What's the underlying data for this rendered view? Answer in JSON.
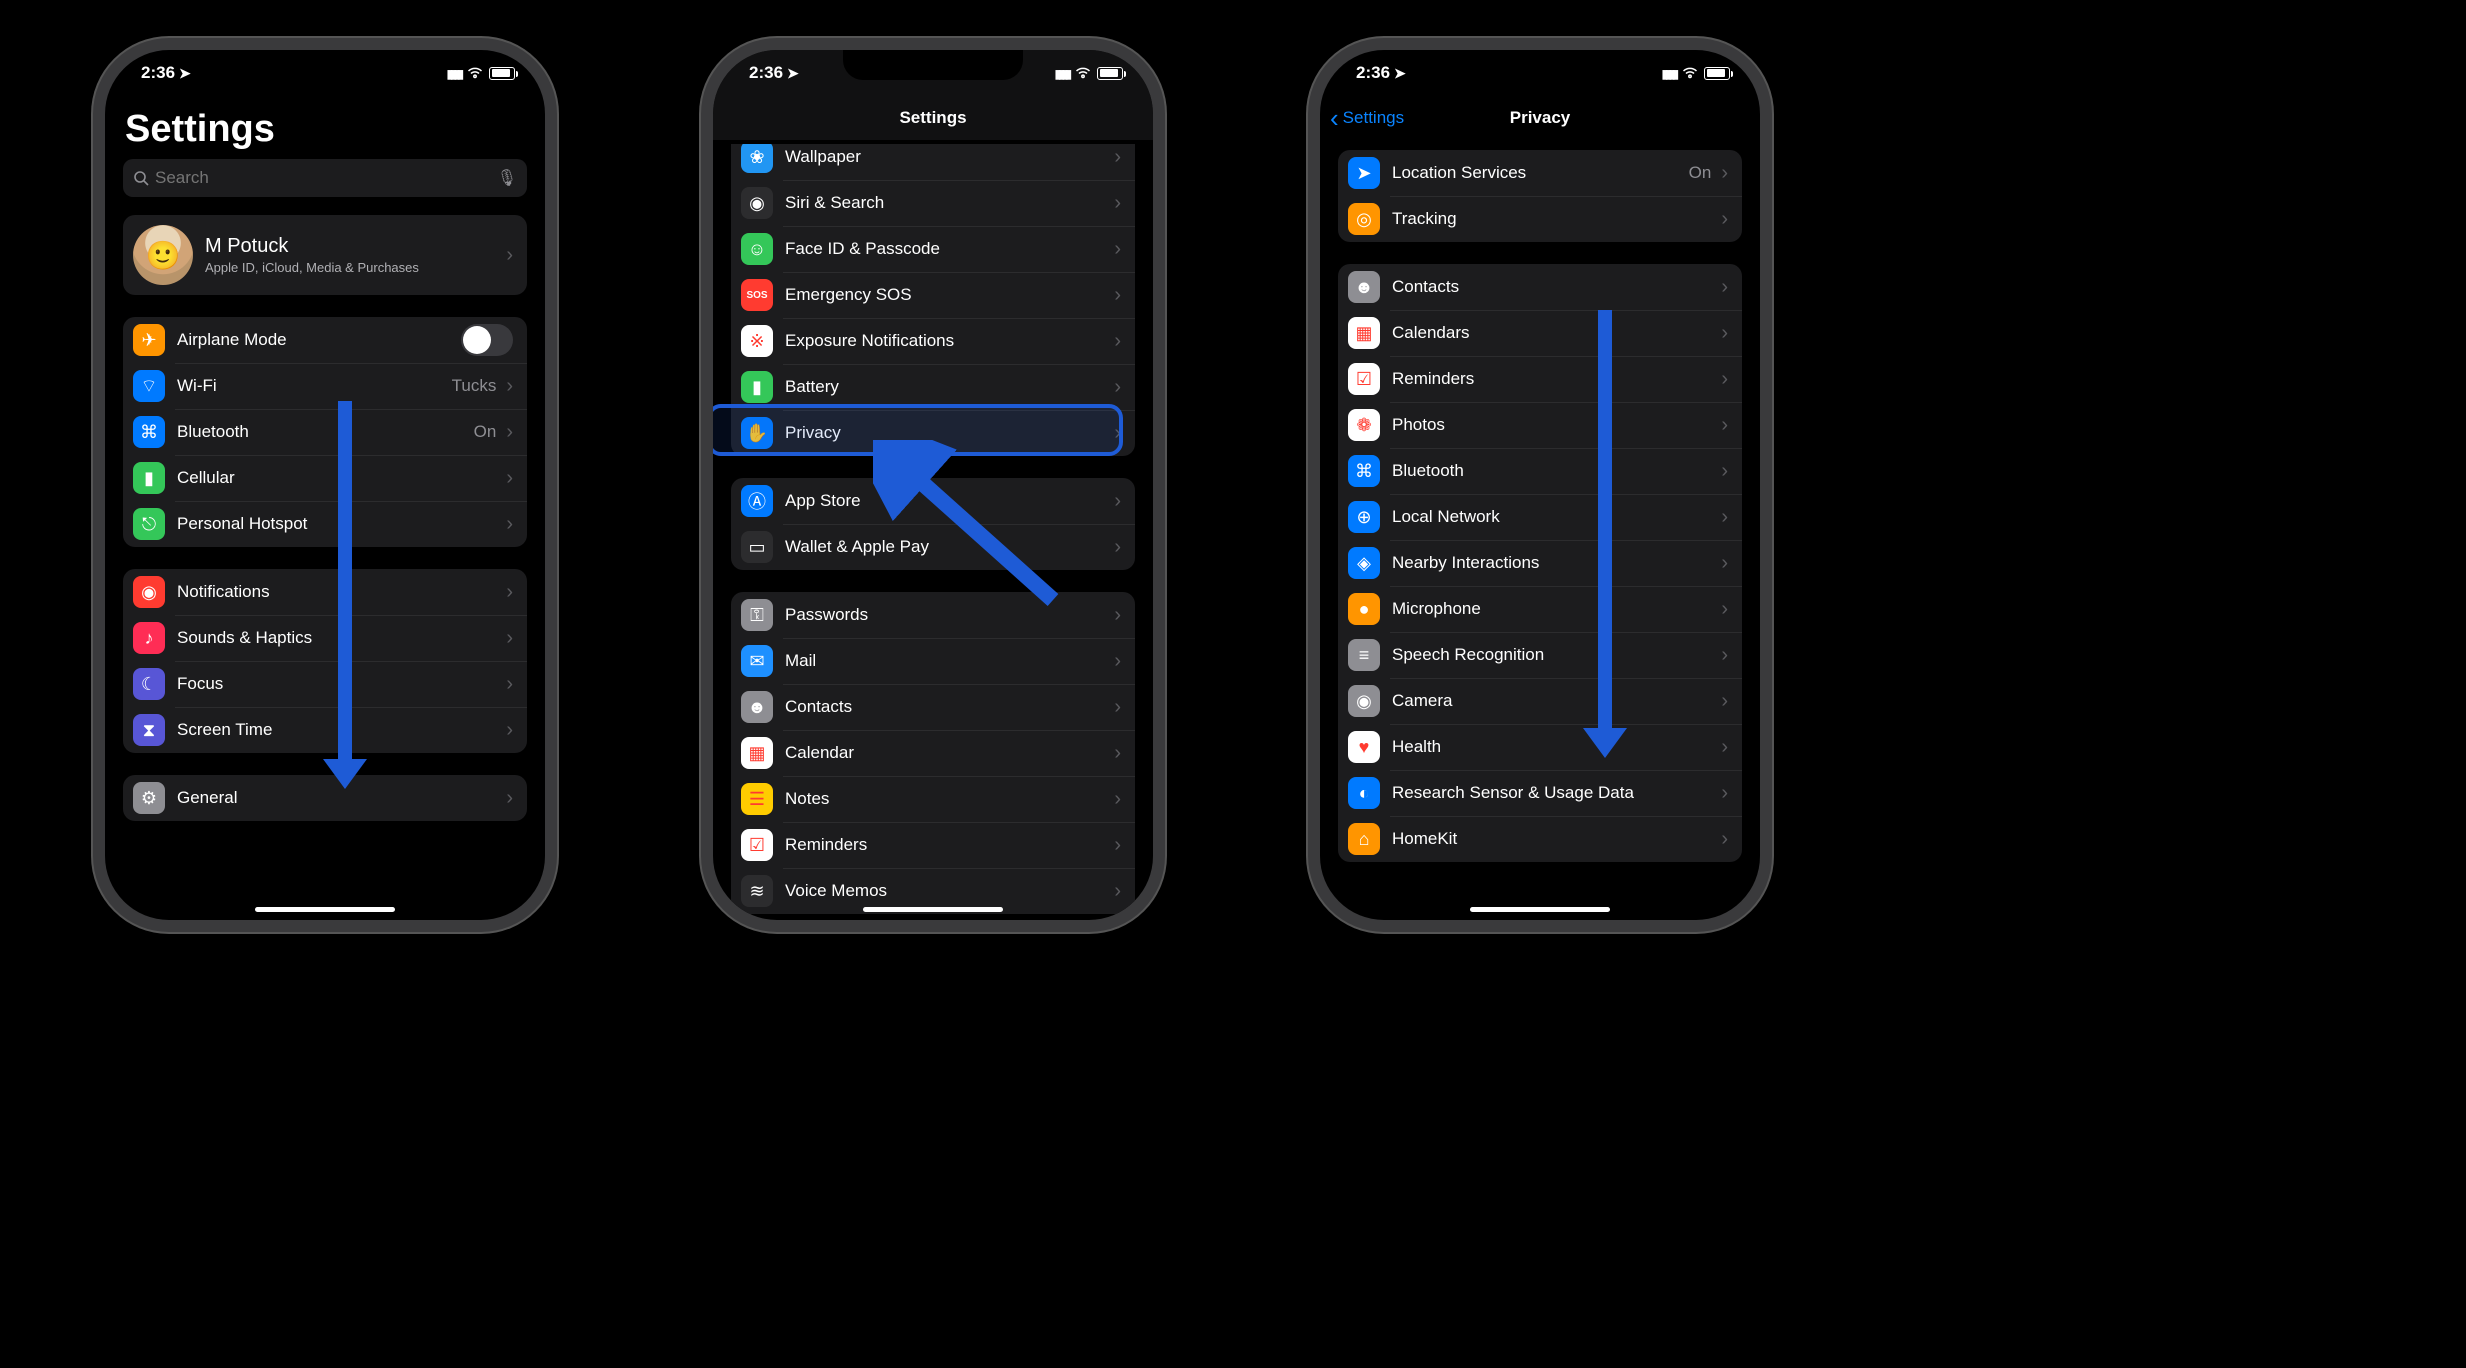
{
  "status": {
    "time": "2:36"
  },
  "phone1": {
    "title": "Settings",
    "search_placeholder": "Search",
    "profile": {
      "name": "M Potuck",
      "sub": "Apple ID, iCloud, Media & Purchases"
    },
    "group_a": [
      {
        "label": "Airplane Mode",
        "icon_bg": "#ff9500",
        "icon": "✈",
        "type": "toggle"
      },
      {
        "label": "Wi-Fi",
        "icon_bg": "#007aff",
        "icon": "⌔",
        "detail": "Tucks",
        "type": "chev"
      },
      {
        "label": "Bluetooth",
        "icon_bg": "#007aff",
        "icon": "⌘",
        "detail": "On",
        "type": "chev"
      },
      {
        "label": "Cellular",
        "icon_bg": "#34c759",
        "icon": "▮",
        "type": "chev"
      },
      {
        "label": "Personal Hotspot",
        "icon_bg": "#34c759",
        "icon": "⎋",
        "type": "chev"
      }
    ],
    "group_b": [
      {
        "label": "Notifications",
        "icon_bg": "#ff3b30",
        "icon": "◉",
        "type": "chev"
      },
      {
        "label": "Sounds & Haptics",
        "icon_bg": "#ff2d55",
        "icon": "♪",
        "type": "chev"
      },
      {
        "label": "Focus",
        "icon_bg": "#5856d6",
        "icon": "☾",
        "type": "chev"
      },
      {
        "label": "Screen Time",
        "icon_bg": "#5856d6",
        "icon": "⧗",
        "type": "chev"
      }
    ],
    "group_c": [
      {
        "label": "General",
        "icon_bg": "#8e8e93",
        "icon": "⚙",
        "type": "chev"
      }
    ]
  },
  "phone2": {
    "nav_title": "Settings",
    "group_a": [
      {
        "label": "Wallpaper",
        "icon_bg": "#2196f3",
        "icon": "❀"
      },
      {
        "label": "Siri & Search",
        "icon_bg": "#2c2c2e",
        "icon": "◉"
      },
      {
        "label": "Face ID & Passcode",
        "icon_bg": "#34c759",
        "icon": "☺"
      },
      {
        "label": "Emergency SOS",
        "icon_bg": "#ff3b30",
        "icon": "SOS"
      },
      {
        "label": "Exposure Notifications",
        "icon_bg": "#fff",
        "icon": "※"
      },
      {
        "label": "Battery",
        "icon_bg": "#34c759",
        "icon": "▮"
      },
      {
        "label": "Privacy",
        "icon_bg": "#007aff",
        "icon": "✋",
        "highlighted": true
      }
    ],
    "group_b": [
      {
        "label": "App Store",
        "icon_bg": "#007aff",
        "icon": "Ⓐ"
      },
      {
        "label": "Wallet & Apple Pay",
        "icon_bg": "#2c2c2e",
        "icon": "▭"
      }
    ],
    "group_c": [
      {
        "label": "Passwords",
        "icon_bg": "#8e8e93",
        "icon": "⚿"
      },
      {
        "label": "Mail",
        "icon_bg": "#1e90ff",
        "icon": "✉"
      },
      {
        "label": "Contacts",
        "icon_bg": "#8e8e93",
        "icon": "☻"
      },
      {
        "label": "Calendar",
        "icon_bg": "#fff",
        "icon": "▦"
      },
      {
        "label": "Notes",
        "icon_bg": "#ffcc00",
        "icon": "☰"
      },
      {
        "label": "Reminders",
        "icon_bg": "#fff",
        "icon": "☑"
      },
      {
        "label": "Voice Memos",
        "icon_bg": "#2c2c2e",
        "icon": "≋"
      }
    ]
  },
  "phone3": {
    "nav_back": "Settings",
    "nav_title": "Privacy",
    "group_a": [
      {
        "label": "Location Services",
        "icon_bg": "#007aff",
        "icon": "➤",
        "detail": "On"
      },
      {
        "label": "Tracking",
        "icon_bg": "#ff9500",
        "icon": "◎"
      }
    ],
    "group_b": [
      {
        "label": "Contacts",
        "icon_bg": "#8e8e93",
        "icon": "☻"
      },
      {
        "label": "Calendars",
        "icon_bg": "#fff",
        "icon": "▦"
      },
      {
        "label": "Reminders",
        "icon_bg": "#fff",
        "icon": "☑"
      },
      {
        "label": "Photos",
        "icon_bg": "#fff",
        "icon": "❁"
      },
      {
        "label": "Bluetooth",
        "icon_bg": "#007aff",
        "icon": "⌘"
      },
      {
        "label": "Local Network",
        "icon_bg": "#007aff",
        "icon": "⊕"
      },
      {
        "label": "Nearby Interactions",
        "icon_bg": "#007aff",
        "icon": "◈"
      },
      {
        "label": "Microphone",
        "icon_bg": "#ff9500",
        "icon": "●"
      },
      {
        "label": "Speech Recognition",
        "icon_bg": "#8e8e93",
        "icon": "≡"
      },
      {
        "label": "Camera",
        "icon_bg": "#8e8e93",
        "icon": "◉"
      },
      {
        "label": "Health",
        "icon_bg": "#fff",
        "icon": "♥"
      },
      {
        "label": "Research Sensor & Usage Data",
        "icon_bg": "#007aff",
        "icon": "◐"
      },
      {
        "label": "HomeKit",
        "icon_bg": "#ff9500",
        "icon": "⌂"
      }
    ]
  }
}
